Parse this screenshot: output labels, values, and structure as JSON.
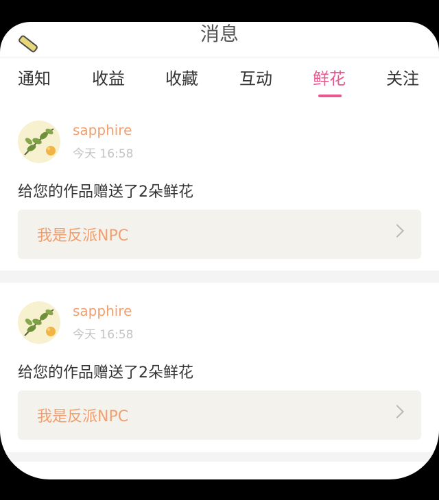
{
  "header": {
    "title": "消息"
  },
  "tabs": [
    {
      "label": "通知"
    },
    {
      "label": "收益"
    },
    {
      "label": "收藏"
    },
    {
      "label": "互动"
    },
    {
      "label": "鲜花",
      "active": true
    },
    {
      "label": "关注"
    }
  ],
  "notifications": [
    {
      "username": "sapphire",
      "time": "今天 16:58",
      "message": "给您的作品赠送了2朵鲜花",
      "work_title": "我是反派NPC",
      "avatar_icon": "plant-leaf-avatar-icon"
    },
    {
      "username": "sapphire",
      "time": "今天 16:58",
      "message": "给您的作品赠送了2朵鲜花",
      "work_title": "我是反派NPC",
      "avatar_icon": "plant-leaf-avatar-icon"
    }
  ],
  "colors": {
    "accent_pink": "#e8578e",
    "username_orange": "#f0a070",
    "card_bg": "#f3f2ec"
  }
}
